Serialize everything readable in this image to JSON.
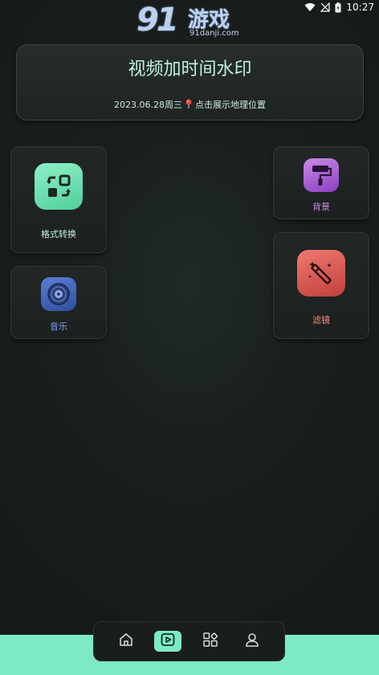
{
  "status_bar": {
    "time": "10:27"
  },
  "logo": {
    "number": "91",
    "name": "游戏",
    "url": "91danji.com"
  },
  "header": {
    "title": "视频加时间水印",
    "date": "2023.06.28周三",
    "location_prompt": "点击展示地理位置"
  },
  "features": {
    "format": {
      "label": "格式转换",
      "icon": "format-convert-icon"
    },
    "music": {
      "label": "音乐",
      "icon": "music-disc-icon"
    },
    "background": {
      "label": "背景",
      "icon": "paint-roller-icon"
    },
    "filter": {
      "label": "滤镜",
      "icon": "magic-wand-icon"
    }
  },
  "nav": {
    "items": [
      {
        "name": "home",
        "icon": "home-icon",
        "active": false
      },
      {
        "name": "video",
        "icon": "video-play-icon",
        "active": true
      },
      {
        "name": "apps",
        "icon": "apps-grid-icon",
        "active": false
      },
      {
        "name": "profile",
        "icon": "user-icon",
        "active": false
      }
    ]
  },
  "colors": {
    "accent": "#7deac6",
    "format_icon": "#5fd9a8",
    "music_icon": "#3d5fb8",
    "background_icon": "#a35ad6",
    "filter_icon": "#d6544f"
  }
}
